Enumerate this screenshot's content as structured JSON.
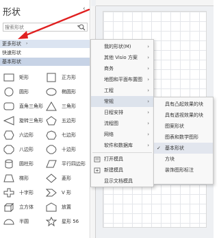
{
  "pane": {
    "title": "形状",
    "collapse": "‹",
    "search_placeholder": "搜索形状",
    "more_shapes": "更多形状",
    "more_arrow": "›",
    "quick_shapes": "快速形状",
    "basic_shapes": "基本形状"
  },
  "shapes": [
    {
      "label": "矩形",
      "icon": "rectangle-icon"
    },
    {
      "label": "正方形",
      "icon": "square-icon"
    },
    {
      "label": "圆形",
      "icon": "circle-icon"
    },
    {
      "label": "椭圆形",
      "icon": "ellipse-icon"
    },
    {
      "label": "直角三角形",
      "icon": "right-triangle-icon"
    },
    {
      "label": "三角形",
      "icon": "triangle-icon"
    },
    {
      "label": "旋转三角形",
      "icon": "rotated-triangle-icon"
    },
    {
      "label": "五边形",
      "icon": "pentagon-icon"
    },
    {
      "label": "六边形",
      "icon": "hexagon-icon"
    },
    {
      "label": "七边形",
      "icon": "heptagon-icon"
    },
    {
      "label": "八边形",
      "icon": "octagon-icon"
    },
    {
      "label": "十边形",
      "icon": "decagon-icon"
    },
    {
      "label": "圆柱形",
      "icon": "cylinder-icon"
    },
    {
      "label": "平行四边形",
      "icon": "parallelogram-icon"
    },
    {
      "label": "梯形",
      "icon": "trapezoid-icon"
    },
    {
      "label": "菱形",
      "icon": "diamond-icon"
    },
    {
      "label": "十字形",
      "icon": "cross-icon"
    },
    {
      "label": "V 形",
      "icon": "chevron-icon"
    },
    {
      "label": "立方体",
      "icon": "cube-icon"
    },
    {
      "label": "放置",
      "icon": "place-icon"
    },
    {
      "label": "半圆",
      "icon": "half-circle-icon"
    },
    {
      "label": "星形 56",
      "icon": "star-icon"
    }
  ],
  "menu1": {
    "items": [
      {
        "label": "我的形状(M)",
        "submenu": true
      },
      {
        "label": "其他 Visio 方案",
        "submenu": true
      },
      {
        "label": "商务",
        "submenu": true
      },
      {
        "label": "地图和平面布置图",
        "submenu": true
      },
      {
        "label": "工程",
        "submenu": true
      },
      {
        "label": "常规",
        "submenu": true,
        "highlighted": true
      },
      {
        "label": "日程安排",
        "submenu": true
      },
      {
        "label": "流程图",
        "submenu": true
      },
      {
        "label": "网络",
        "submenu": true
      },
      {
        "label": "软件和数据库",
        "submenu": true
      }
    ],
    "actions": [
      {
        "label": "打开模具",
        "icon": "open-stencil-icon"
      },
      {
        "label": "新建模具",
        "icon": "new-stencil-icon"
      },
      {
        "label": "显示文档模具",
        "icon": ""
      }
    ]
  },
  "menu2": {
    "items": [
      {
        "label": "具有凸起效果的块"
      },
      {
        "label": "具有透视效果的块"
      },
      {
        "label": "图案形状"
      },
      {
        "label": "图表和数学图形"
      },
      {
        "label": "基本形状",
        "checked": true
      },
      {
        "label": "方块"
      },
      {
        "label": "装饰图形标注"
      }
    ]
  },
  "colors": {
    "selected_row": "#c7d3e6",
    "hover_row": "#dbe4f1",
    "annotation_arrow": "#e02020"
  }
}
